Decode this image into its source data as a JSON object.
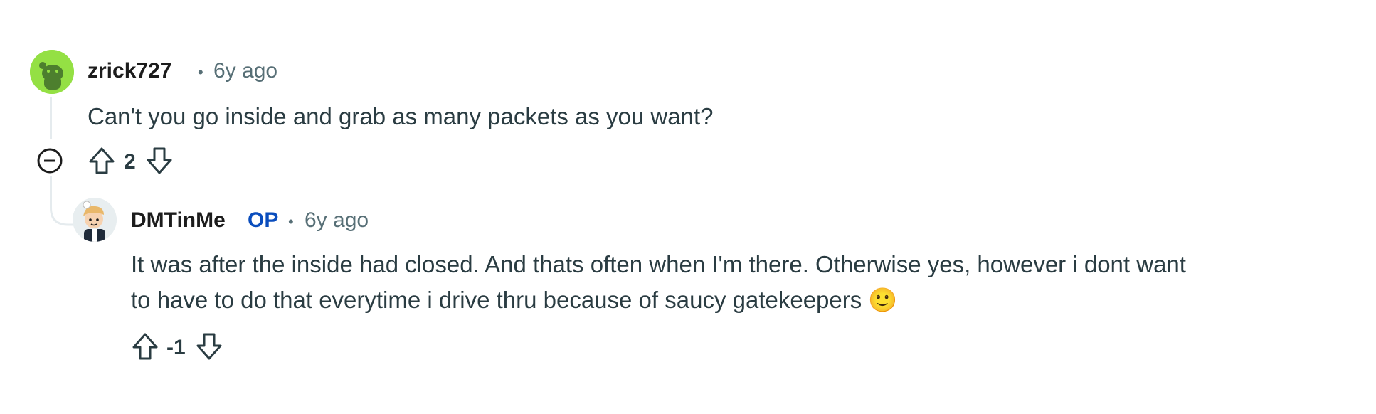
{
  "comments": [
    {
      "username": "zrick727",
      "time": "6y ago",
      "separator": "•",
      "body_lines": [
        "Can't you go inside and grab as many packets as you want?"
      ],
      "votes": "2",
      "avatar_icon": "reddit-snoo-avatar-icon"
    },
    {
      "username": "DMTinMe",
      "op_badge": "OP",
      "time": "6y ago",
      "separator": "•",
      "body_lines": [
        "It was after the inside had closed. And thats often when I'm there. Otherwise yes, however i dont want",
        "to have to do that everytime i drive thru because of saucy gatekeepers 🙂"
      ],
      "votes": "-1",
      "avatar_icon": "user-avatar-icon"
    }
  ],
  "icons": {
    "collapse": "collapse-thread-icon",
    "upvote": "upvote-arrow-icon",
    "downvote": "downvote-arrow-icon"
  },
  "colors": {
    "text_primary": "#1c1c1c",
    "text_meta": "#576f76",
    "op_badge": "#0a4dbd",
    "thread_line": "#e5ebee",
    "avatar_green": "#94e044"
  }
}
